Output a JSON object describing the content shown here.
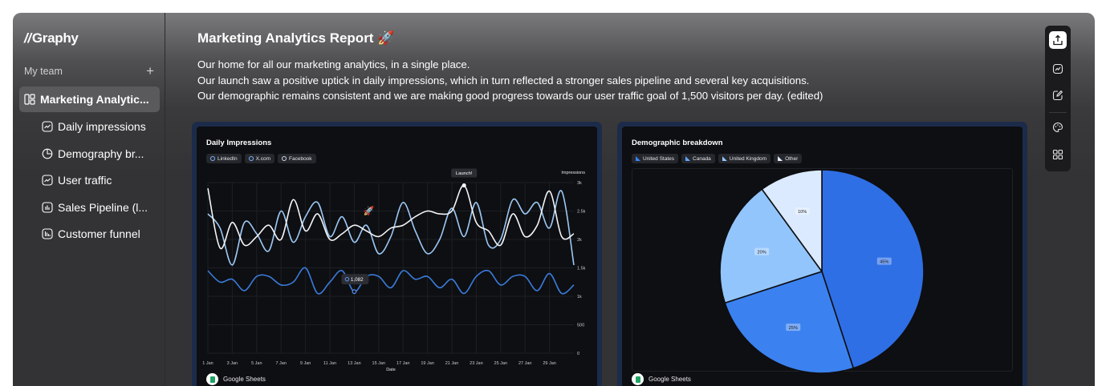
{
  "brand": {
    "name": "Graphy",
    "mark": "//"
  },
  "sidebar": {
    "team_label": "My team",
    "add_symbol": "+",
    "items": [
      {
        "label": "Marketing Analytic...",
        "icon": "dashboard-icon",
        "active": true
      },
      {
        "label": "Daily impressions",
        "icon": "line-chart-icon"
      },
      {
        "label": "Demography br...",
        "icon": "pie-chart-icon"
      },
      {
        "label": "User traffic",
        "icon": "line-chart-icon"
      },
      {
        "label": "Sales Pipeline (l...",
        "icon": "bar-chart-icon"
      },
      {
        "label": "Customer funnel",
        "icon": "bar-chart-icon"
      }
    ]
  },
  "header": {
    "title": "Marketing Analytics Report 🚀",
    "description": [
      "Our home for all our marketing analytics, in a single place.",
      "Our launch saw a positive uptick in daily impressions, which in turn reflected a stronger sales pipeline and several key acquisitions.",
      "Our demographic remains consistent and we are making good progress towards our user traffic goal of 1,500 visitors per day. (edited)"
    ]
  },
  "toolbar": {
    "tools": [
      "share-icon",
      "chart-icon",
      "edit-icon",
      "palette-icon",
      "grid-icon"
    ]
  },
  "impressions_card": {
    "title": "Daily Impressions",
    "legend": [
      {
        "name": "LinkedIn",
        "color": "#ffffff"
      },
      {
        "name": "X.com",
        "color": "#8fc3ff"
      },
      {
        "name": "Facebook",
        "color": "#cfd8e6"
      }
    ],
    "annotation_launch": "Launch!",
    "tooltip_value": "1,082",
    "y_axis_title": "Impressions",
    "x_axis_title": "Date",
    "source": "Google Sheets"
  },
  "demographic_card": {
    "title": "Demographic breakdown",
    "legend": [
      {
        "name": "United States",
        "color": "#2f6fe6"
      },
      {
        "name": "Canada",
        "color": "#3b82f0"
      },
      {
        "name": "United Kingdom",
        "color": "#93c5fd"
      },
      {
        "name": "Other",
        "color": "#dbeafe"
      }
    ],
    "source": "Google Sheets"
  },
  "chart_data": [
    {
      "type": "line",
      "title": "Daily Impressions",
      "xlabel": "Date",
      "ylabel": "Impressions",
      "ylim": [
        0,
        3000
      ],
      "y_ticks": [
        "0",
        "500",
        "1k",
        "1.5k",
        "2k",
        "2.5k",
        "3k"
      ],
      "x_ticks": [
        "1 Jan",
        "3 Jan",
        "5 Jan",
        "7 Jan",
        "9 Jan",
        "11 Jan",
        "13 Jan",
        "15 Jan",
        "17 Jan",
        "19 Jan",
        "21 Jan",
        "23 Jan",
        "25 Jan",
        "27 Jan",
        "29 Jan"
      ],
      "x": [
        1,
        2,
        3,
        4,
        5,
        6,
        7,
        8,
        9,
        10,
        11,
        12,
        13,
        14,
        15,
        16,
        17,
        18,
        19,
        20,
        21,
        22,
        23,
        24,
        25,
        26,
        27,
        28,
        29,
        30,
        31
      ],
      "series": [
        {
          "name": "LinkedIn",
          "color": "#f2f4f7",
          "values": [
            2900,
            1850,
            2300,
            1900,
            2050,
            2250,
            2000,
            2700,
            2150,
            2450,
            2000,
            2100,
            2250,
            2150,
            2050,
            2200,
            2250,
            2400,
            2500,
            2450,
            2500,
            2950,
            2300,
            2150,
            1900,
            2450,
            2050,
            2250,
            2850,
            2050,
            2100
          ]
        },
        {
          "name": "X.com",
          "color": "#9cc8f5",
          "values": [
            2450,
            2200,
            1550,
            2300,
            2100,
            1800,
            2500,
            1950,
            2400,
            2650,
            2050,
            2400,
            1950,
            2250,
            1750,
            2050,
            2650,
            2150,
            1750,
            2000,
            2550,
            2050,
            2650,
            1900,
            2000,
            2700,
            2450,
            2650,
            2200,
            2850,
            1550
          ]
        },
        {
          "name": "Facebook",
          "color": "#3a7bdc",
          "values": [
            1450,
            1250,
            1300,
            1100,
            1350,
            1350,
            1200,
            1250,
            1500,
            1050,
            1250,
            1450,
            1082,
            1350,
            1350,
            1150,
            1450,
            1300,
            1350,
            1150,
            1300,
            1050,
            1350,
            1450,
            1200,
            1350,
            1350,
            1100,
            1400,
            1050,
            1200
          ]
        }
      ]
    },
    {
      "type": "pie",
      "title": "Demographic breakdown",
      "categories": [
        "United States",
        "Canada",
        "United Kingdom",
        "Other"
      ],
      "values": [
        45,
        25,
        20,
        10
      ],
      "labels": [
        "45%",
        "25%",
        "20%",
        "10%"
      ],
      "colors": [
        "#2f6fe6",
        "#3b82f0",
        "#93c5fd",
        "#dbeafe"
      ]
    }
  ]
}
